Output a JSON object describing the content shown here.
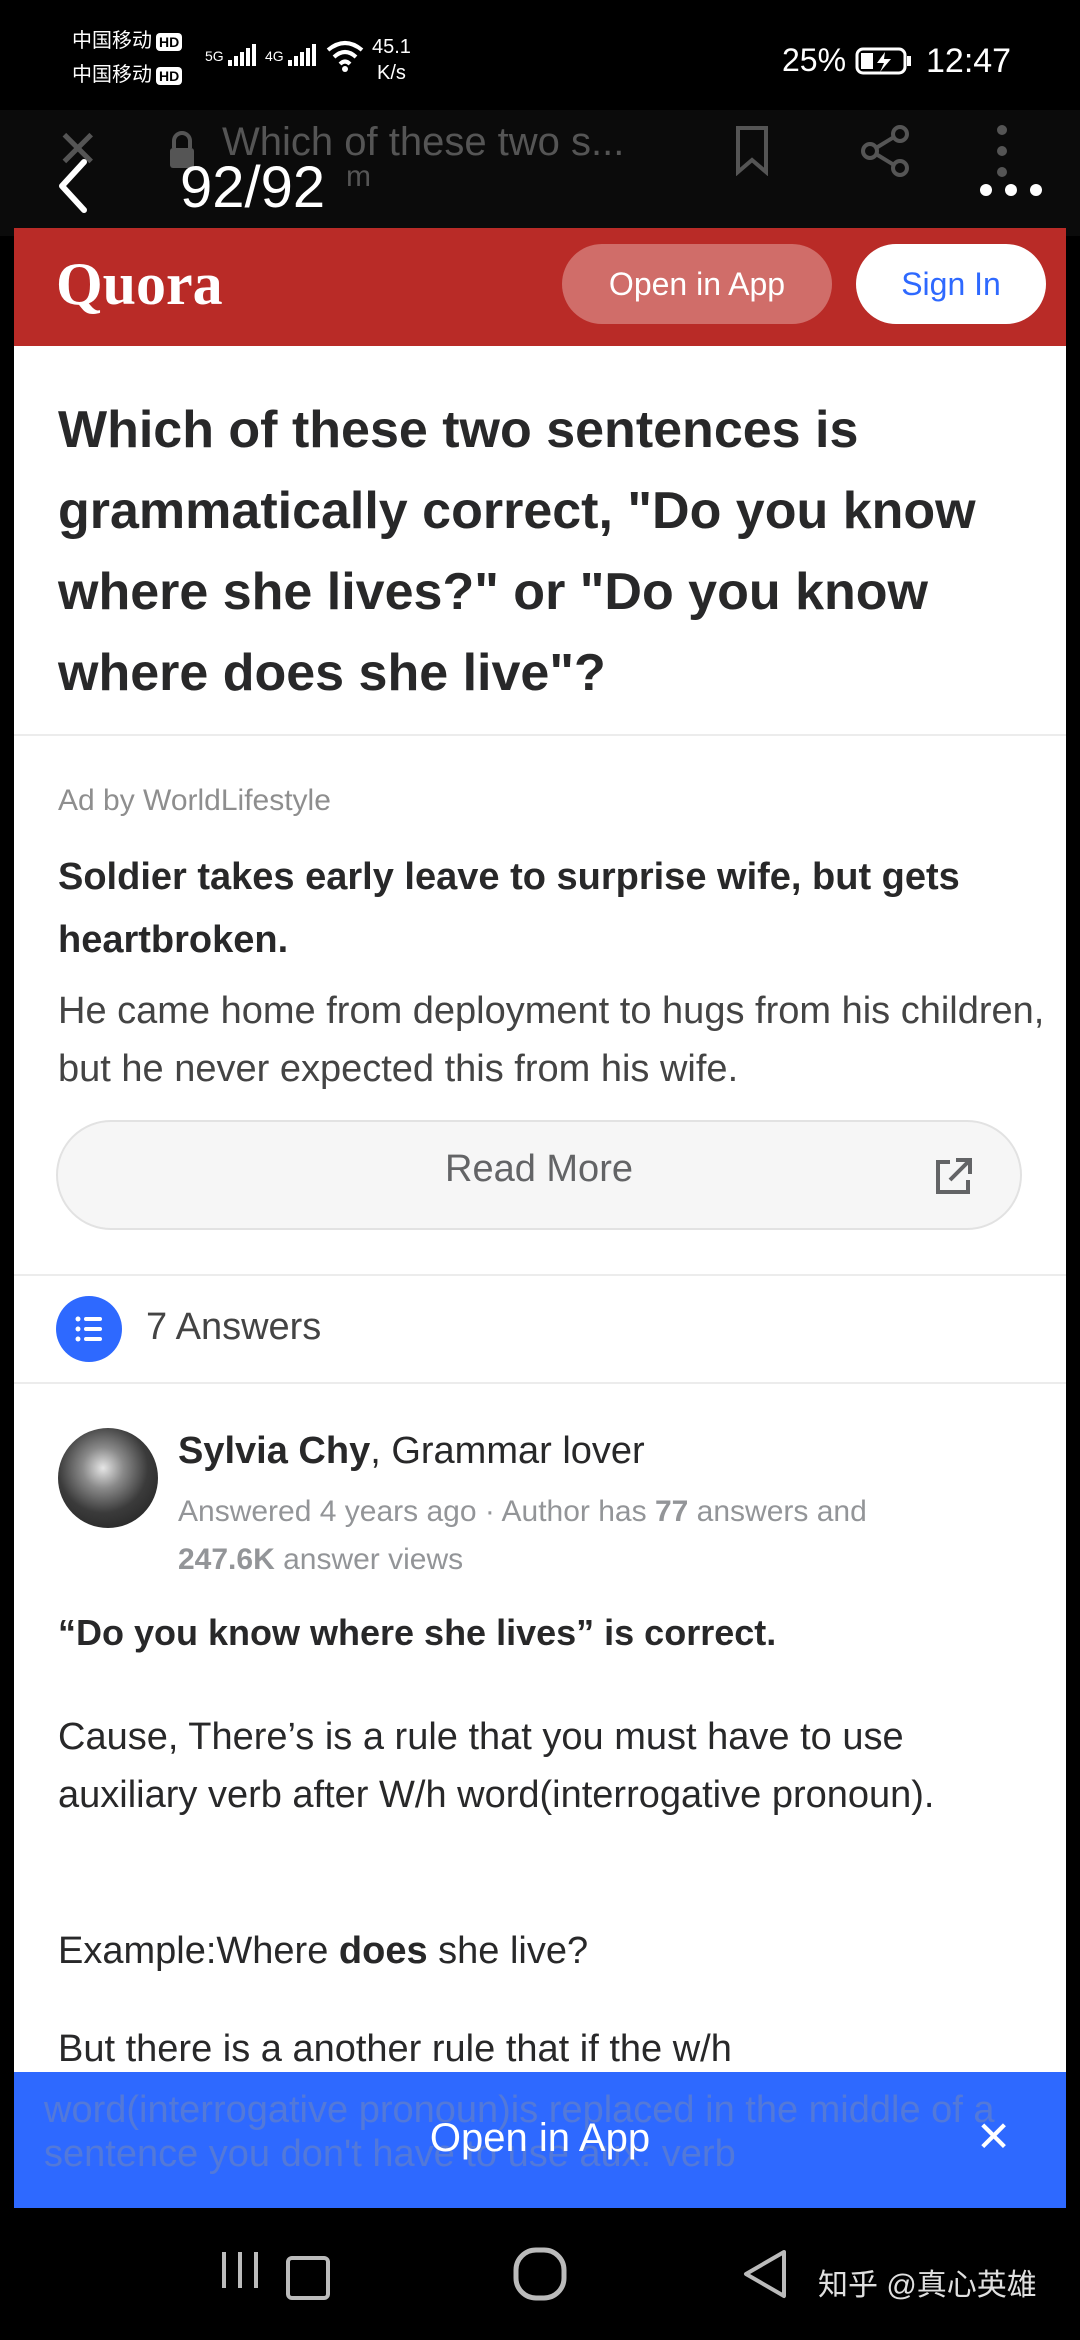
{
  "status_bar": {
    "carrier1": "中国移动",
    "carrier2": "中国移动",
    "hd_badge": "HD",
    "net1": "5G",
    "net2": "4G",
    "speed": "45.1",
    "speed_unit": "K/s",
    "battery": "25%",
    "time": "12:47"
  },
  "browser": {
    "page_title": "Which of these two s...",
    "url_hint": "m",
    "counter": "92/92"
  },
  "quora_header": {
    "logo": "Quora",
    "open_in_app": "Open in App",
    "sign_in": "Sign In"
  },
  "question": {
    "title": "Which of these two sentences is grammatically correct, \"Do you know where she lives?\" or \"Do you know where does she live\"?"
  },
  "ad": {
    "by": "Ad by WorldLifestyle",
    "title": "Soldier takes early leave to surprise wife, but gets heartbroken.",
    "body": "He came home from deployment to hugs from his children, but he never expected this from his wife.",
    "cta": "Read More"
  },
  "answers": {
    "count_label": "7 Answers"
  },
  "answer": {
    "author_name": "Sylvia Chy",
    "author_cred": ", Grammar lover",
    "meta_prefix": "Answered 4 years ago · Author has ",
    "meta_count": "77",
    "meta_mid": " answers and",
    "meta_views": "247.6K",
    "meta_suffix": " answer views",
    "p1": "“Do you know where she lives” is correct.",
    "p2": "Cause, There’s is a rule that you must have to use auxiliary verb after W/h word(interrogative pronoun).",
    "p3_pre": "Example:Where ",
    "p3_bold": "does",
    "p3_post": " she live?",
    "p4": "But there is a another rule that if the w/h",
    "p5_hidden": "word(interrogative pronoun)is replaced in the middle of a sentence you don't have to use aux. verb"
  },
  "bottom_banner": {
    "label": "Open in App"
  },
  "nav_bar": {
    "watermark": "知乎 @真心英雄"
  }
}
